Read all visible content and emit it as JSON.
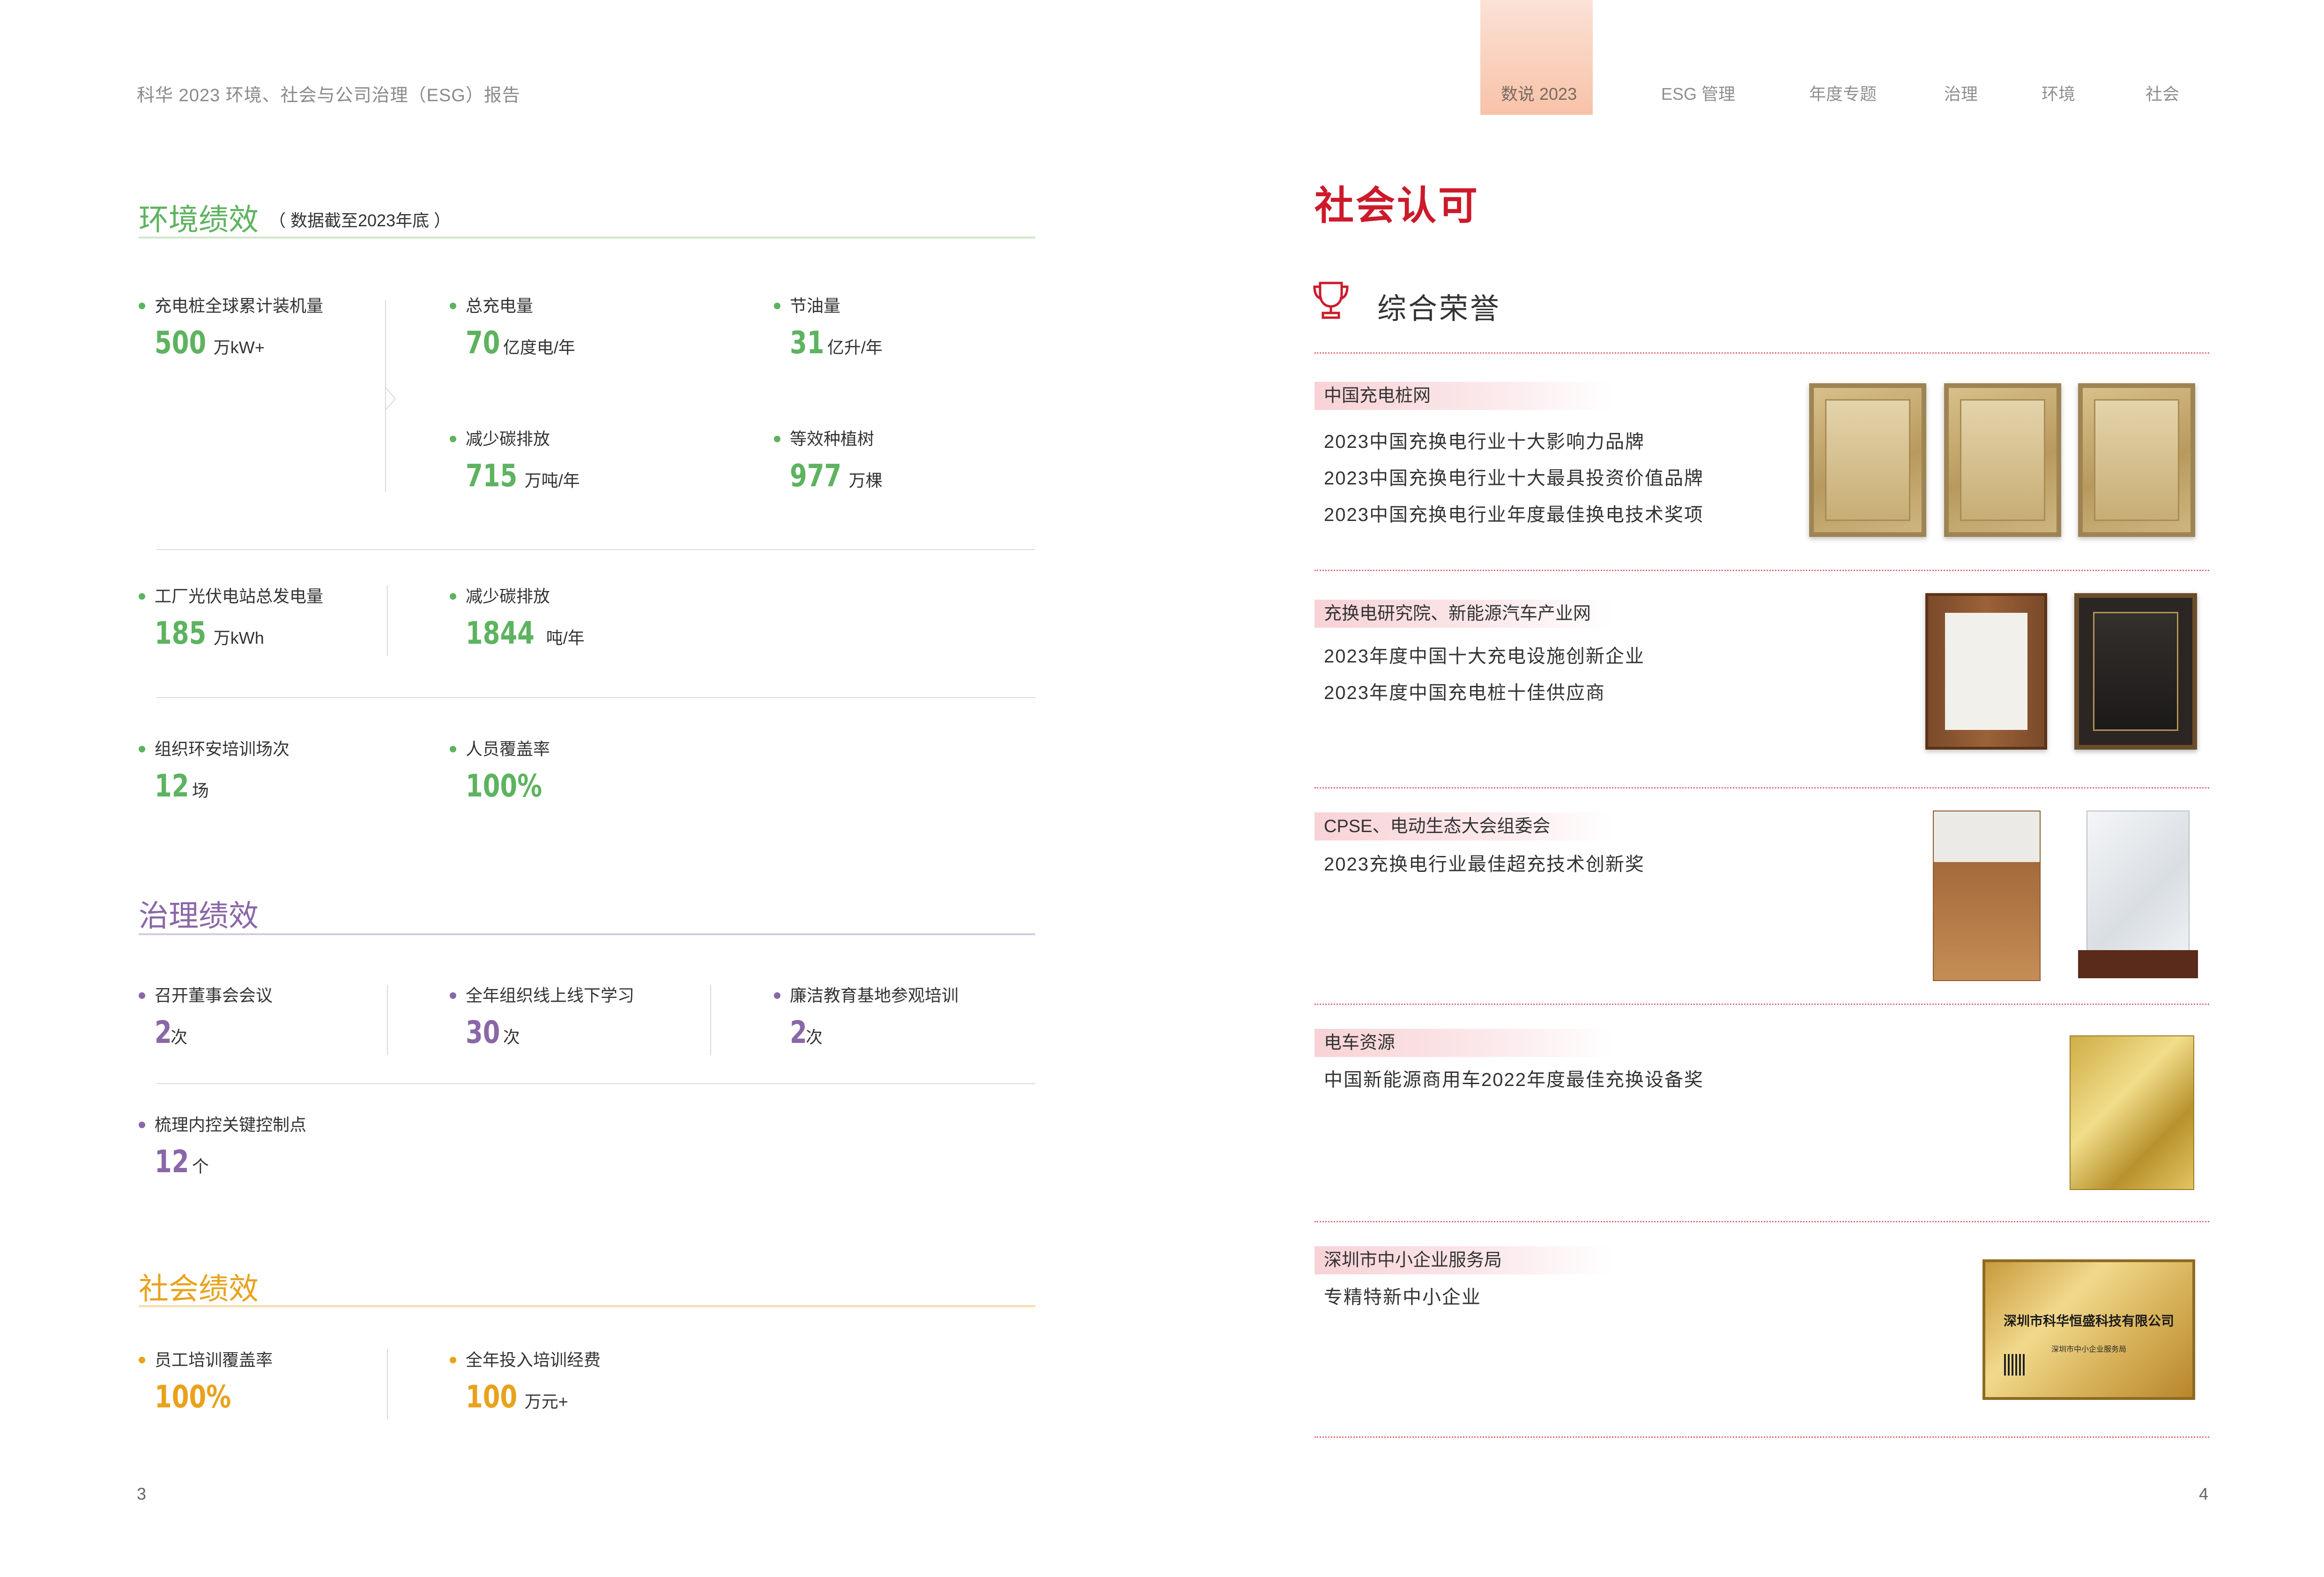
{
  "header": {
    "report_title": "科华 2023 环境、社会与公司治理（ESG）报告",
    "nav": [
      "数说 2023",
      "ESG 管理",
      "年度专题",
      "治理",
      "环境",
      "社会"
    ],
    "active_nav": "数说 2023"
  },
  "pages": {
    "left": "3",
    "right": "4"
  },
  "colors": {
    "environment": "#5db35f",
    "governance": "#8a67a8",
    "social": "#e8a21c",
    "accent_red": "#cc1a2a"
  },
  "environment": {
    "title": "环境绩效",
    "note": "（ 数据截至2023年底 ）",
    "metrics": [
      {
        "label": "充电桩全球累计装机量",
        "value": "500",
        "unit": "万kW+"
      },
      {
        "label": "总充电量",
        "value": "70",
        "unit": "亿度电/年"
      },
      {
        "label": "节油量",
        "value": "31",
        "unit": "亿升/年"
      },
      {
        "label": "减少碳排放",
        "value": "715",
        "unit": "万吨/年"
      },
      {
        "label": "等效种植树",
        "value": "977",
        "unit": "万棵"
      },
      {
        "label": "工厂光伏电站总发电量",
        "value": "185",
        "unit": "万kWh"
      },
      {
        "label": "减少碳排放",
        "value": "1844",
        "unit": "吨/年"
      },
      {
        "label": "组织环安培训场次",
        "value": "12",
        "unit": "场"
      },
      {
        "label": "人员覆盖率",
        "value": "100%",
        "unit": ""
      }
    ]
  },
  "governance": {
    "title": "治理绩效",
    "metrics": [
      {
        "label": "召开董事会会议",
        "value": "2",
        "unit": "次"
      },
      {
        "label": "全年组织线上线下学习",
        "value": "30",
        "unit": "次"
      },
      {
        "label": "廉洁教育基地参观培训",
        "value": "2",
        "unit": "次"
      },
      {
        "label": "梳理内控关键控制点",
        "value": "12",
        "unit": "个"
      }
    ]
  },
  "social": {
    "title": "社会绩效",
    "metrics": [
      {
        "label": "员工培训覆盖率",
        "value": "100%",
        "unit": ""
      },
      {
        "label": "全年投入培训经费",
        "value": "100",
        "unit": "万元+"
      }
    ]
  },
  "recognition": {
    "title": "社会认可",
    "subtitle": "综合荣誉",
    "trophy_icon": "trophy-icon",
    "groups": [
      {
        "source": "中国充电桩网",
        "awards": [
          "2023中国充换电行业十大影响力品牌",
          "2023中国充换电行业十大最具投资价值品牌",
          "2023中国充换电行业年度最佳换电技术奖项"
        ]
      },
      {
        "source": "充换电研究院、新能源汽车产业网",
        "awards": [
          "2023年度中国十大充电设施创新企业",
          "2023年度中国充电桩十佳供应商"
        ]
      },
      {
        "source": "CPSE、电动生态大会组委会",
        "awards": [
          "2023充换电行业最佳超充技术创新奖"
        ]
      },
      {
        "source": "电车资源",
        "awards": [
          "中国新能源商用车2022年度最佳充换设备奖"
        ]
      },
      {
        "source": "深圳市中小企业服务局",
        "awards": [
          "专精特新中小企业"
        ]
      }
    ],
    "certificate": {
      "company": "深圳市科华恒盛科技有限公司",
      "issuer": "深圳市中小企业服务局"
    }
  }
}
